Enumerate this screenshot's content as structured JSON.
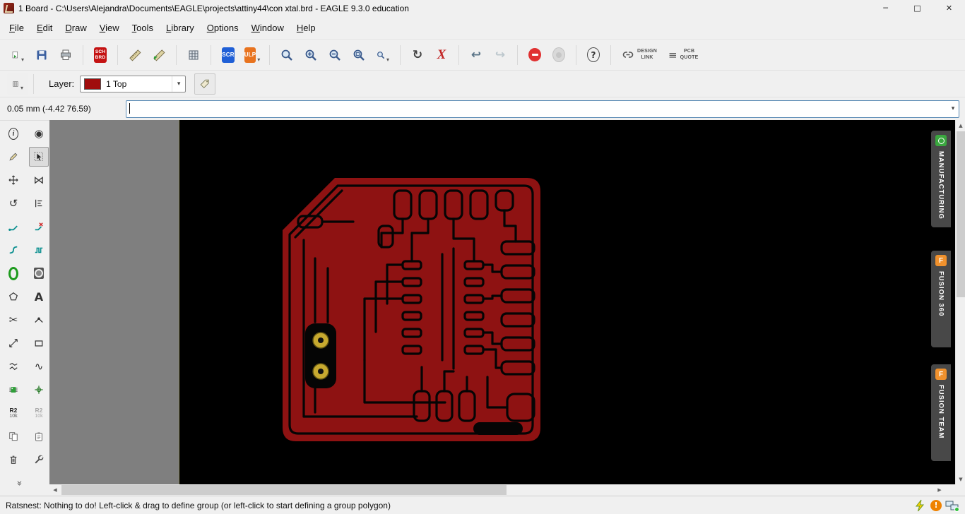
{
  "window": {
    "title": "1 Board - C:\\Users\\Alejandra\\Documents\\EAGLE\\projects\\attiny44\\con xtal.brd - EAGLE 9.3.0 education"
  },
  "icons": {
    "minimize": "─",
    "maximize": "□",
    "close": "✕",
    "dropdown": "▾",
    "scroll_up": "▲",
    "scroll_down": "▼",
    "scroll_left": "◀",
    "scroll_right": "▶",
    "redraw": "↻",
    "undo": "↩",
    "redo": "↪",
    "rotate": "↺",
    "show": "◉",
    "mirror": "⋈",
    "split": "✂",
    "signal": "∿",
    "text_tool": "A",
    "info": "i",
    "help": "?",
    "warning": "!",
    "x_tool": "X",
    "list": "≡",
    "chevrons": "»"
  },
  "menu": {
    "items": [
      "File",
      "Edit",
      "Draw",
      "View",
      "Tools",
      "Library",
      "Options",
      "Window",
      "Help"
    ]
  },
  "toolbar": {
    "sch_badge": [
      "SCH",
      "BRD"
    ],
    "scr_badge": "SCR",
    "ulp_badge": "ULP",
    "design_link": [
      "DESIGN",
      "LINK"
    ],
    "pcb_quote": [
      "PCB",
      "QUOTE"
    ]
  },
  "layerbar": {
    "label": "Layer:",
    "selected_layer": "1 Top"
  },
  "commandbar": {
    "coordinates": "0.05 mm (-4.42 76.59)",
    "value": "",
    "placeholder": ""
  },
  "toolpanel": {
    "value_top": "R2",
    "value_bottom": "10k",
    "smash_top": "R2",
    "smash_bottom": "10k"
  },
  "side_tabs": [
    {
      "label": "MANUFACTURING"
    },
    {
      "label": "FUSION 360"
    },
    {
      "label": "FUSION TEAM"
    }
  ],
  "statusbar": {
    "message": "Ratsnest: Nothing to do! Left-click & drag to define group (or left-click to start defining a group polygon)"
  },
  "colors": {
    "board_red": "#8e1212",
    "canvas_black": "#000000",
    "canvas_margin_gray": "#7f7f7f",
    "layer_swatch_red": "#a00d0d",
    "manufacturing_green": "#3aa73f",
    "fusion_orange": "#f0912d",
    "scr_blue": "#1f5fd6",
    "schbrd_red": "#c41212",
    "ulp_orange": "#e8731f",
    "stop_red": "#e03131",
    "pad_gold": "#c7a92f"
  }
}
